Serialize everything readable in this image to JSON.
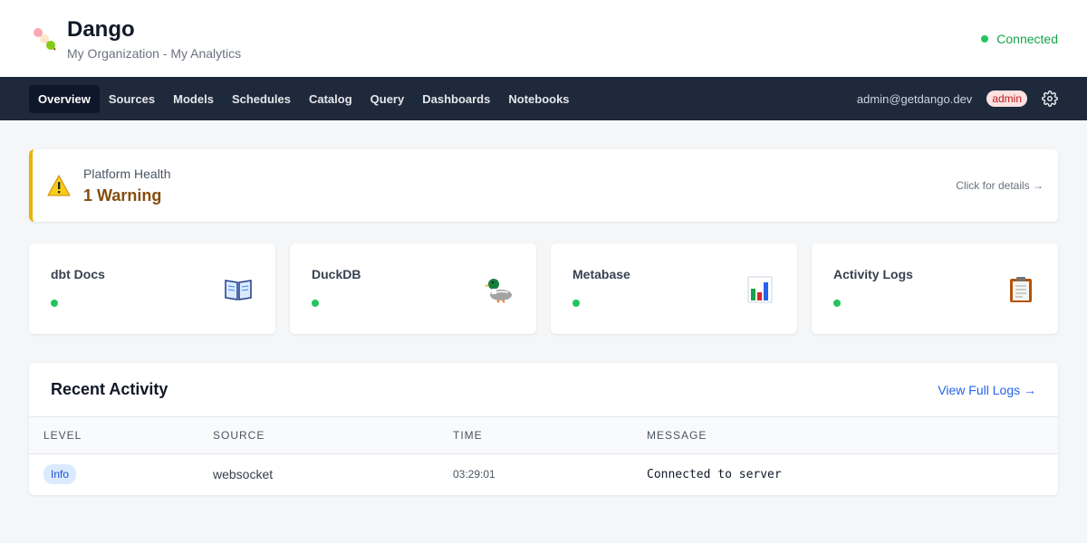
{
  "header": {
    "title": "Dango",
    "subtitle": "My Organization - My Analytics",
    "status": "Connected",
    "colors": {
      "status": "#22c55e"
    }
  },
  "nav": {
    "tabs": [
      {
        "label": "Overview",
        "active": true
      },
      {
        "label": "Sources"
      },
      {
        "label": "Models"
      },
      {
        "label": "Schedules"
      },
      {
        "label": "Catalog"
      },
      {
        "label": "Query"
      },
      {
        "label": "Dashboards"
      },
      {
        "label": "Notebooks"
      }
    ],
    "email": "admin@getdango.dev",
    "role": "admin",
    "settings_icon": "gear-icon"
  },
  "health": {
    "label": "Platform Health",
    "value": "1 Warning",
    "link": "Click for details →",
    "icon": "warning-icon",
    "accent": "#eab308"
  },
  "services": [
    {
      "name": "dbt Docs",
      "icon": "book-icon"
    },
    {
      "name": "DuckDB",
      "icon": "duck-icon"
    },
    {
      "name": "Metabase",
      "icon": "bar-chart-icon"
    },
    {
      "name": "Activity Logs",
      "icon": "clipboard-icon"
    }
  ],
  "activity": {
    "title": "Recent Activity",
    "link": "View Full Logs →",
    "columns": [
      "LEVEL",
      "SOURCE",
      "TIME",
      "MESSAGE"
    ],
    "rows": [
      {
        "level": "Info",
        "source": "websocket",
        "time": "03:29:01",
        "message": "Connected to server"
      }
    ]
  }
}
